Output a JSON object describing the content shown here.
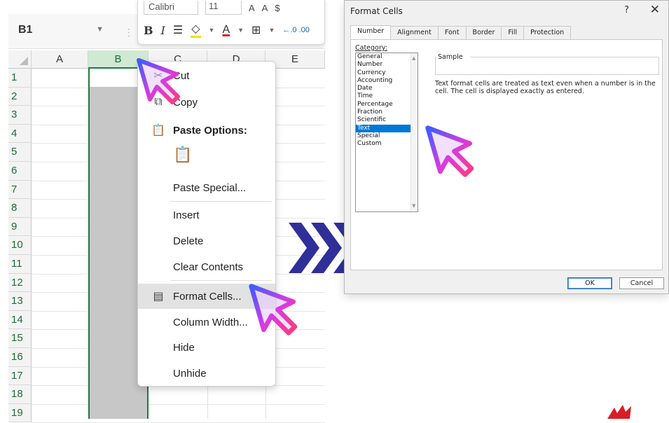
{
  "sheet": {
    "name_box": "B1",
    "columns": [
      "A",
      "B",
      "C",
      "D",
      "E"
    ],
    "selected_column": "B",
    "rows": [
      "1",
      "2",
      "3",
      "4",
      "5",
      "6",
      "7",
      "8",
      "9",
      "10",
      "11",
      "12",
      "13",
      "14",
      "15",
      "16",
      "17",
      "18",
      "19"
    ]
  },
  "mini_toolbar": {
    "font": "Calibri",
    "size": "11",
    "bold": "B",
    "italic": "I",
    "font_color_glyph": "A",
    "decimal_glyph": "←.0 .00"
  },
  "context_menu": {
    "cut": "Cut",
    "copy": "Copy",
    "paste_options": "Paste Options:",
    "paste_special": "Paste Special...",
    "insert": "Insert",
    "delete": "Delete",
    "clear_contents": "Clear Contents",
    "format_cells": "Format Cells...",
    "column_width": "Column Width...",
    "hide": "Hide",
    "unhide": "Unhide"
  },
  "dialog": {
    "title": "Format Cells",
    "help": "?",
    "close": "✕",
    "tabs": [
      "Number",
      "Alignment",
      "Font",
      "Border",
      "Fill",
      "Protection"
    ],
    "active_tab": "Number",
    "category_label": "Category:",
    "categories": [
      "General",
      "Number",
      "Currency",
      "Accounting",
      "Date",
      "Time",
      "Percentage",
      "Fraction",
      "Scientific",
      "Text",
      "Special",
      "Custom"
    ],
    "selected_category": "Text",
    "sample_label": "Sample",
    "description": "Text format cells are treated as text even when a number is in the cell. The cell is displayed exactly as entered.",
    "ok": "OK",
    "cancel": "Cancel"
  },
  "colors": {
    "excel_green": "#1f7a3f",
    "selection_blue": "#0078d7",
    "chevron_blue": "#2f2f9a",
    "pointer_gradient": [
      "#3b5cff",
      "#d83be0",
      "#ff3b7a"
    ]
  }
}
